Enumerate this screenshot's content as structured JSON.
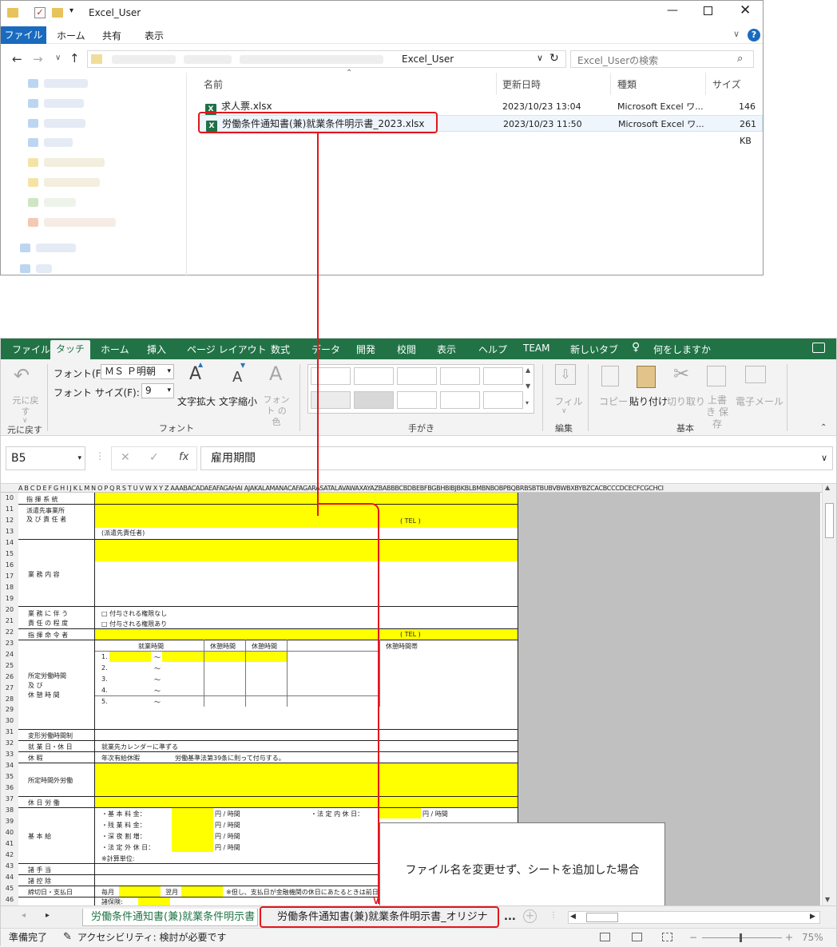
{
  "explorer": {
    "title": "Excel_User",
    "ribbon_tabs": [
      "ファイル",
      "ホーム",
      "共有",
      "表示"
    ],
    "address_tail": "Excel_User",
    "search_placeholder": "Excel_Userの検索",
    "columns": {
      "name": "名前",
      "date": "更新日時",
      "type": "種類",
      "size": "サイズ"
    },
    "files": [
      {
        "name": "求人票.xlsx",
        "date": "2023/10/23 13:04",
        "type": "Microsoft Excel ワ...",
        "size": "146 KB"
      },
      {
        "name": "労働条件通知書(兼)就業条件明示書_2023.xlsx",
        "date": "2023/10/23 11:50",
        "type": "Microsoft Excel ワ...",
        "size": "261 KB"
      }
    ]
  },
  "excel": {
    "menu": [
      "ファイル",
      "タッチ",
      "ホーム",
      "挿入",
      "ページ レイアウト",
      "数式",
      "データ",
      "開発",
      "校閲",
      "表示",
      "ヘルプ",
      "TEAM",
      "新しいタブ"
    ],
    "tell_me": "何をしますか",
    "ribbon": {
      "undo_label": "元に戻す",
      "undo_group": "元に戻す",
      "font_label": "フォント(F):",
      "font_value": "ＭＳ Ｐ明朝",
      "size_label": "フォント サイズ(F):",
      "size_value": "9",
      "grow": "文字拡大",
      "shrink": "文字縮小",
      "font_color": "フォント の色",
      "font_group": "フォント",
      "ink_group": "手がき",
      "fill": "フィル",
      "edit_group": "編集",
      "copy": "コピー",
      "paste": "貼り付け",
      "cut": "切り取り",
      "overwrite": "上書き 保存",
      "email": "電子メール",
      "basic_group": "基本"
    },
    "name_box": "B5",
    "formula": "雇用期間",
    "col_header": "A B C D E F G H I J K L M N O P Q R S T U V W X Y Z AAABACADAEAFAGAHAI AJAKALAMANACAFAGARASATALAVAWAXAYAZBABBBCBDBEBFBGBHBIBJBKBLBMBNBOBPBQBRBSBTBUBVBWBXBYBZCACBCCCDCECFCGCHCI",
    "rows": [
      "10",
      "11",
      "12",
      "13",
      "14",
      "15",
      "16",
      "17",
      "18",
      "19",
      "20",
      "21",
      "22",
      "23",
      "24",
      "25",
      "26",
      "27",
      "28",
      "29",
      "30",
      "31",
      "32",
      "33",
      "34",
      "35",
      "36",
      "37",
      "38",
      "39",
      "40",
      "41",
      "42",
      "43",
      "44",
      "45",
      "46"
    ],
    "labels": {
      "r10": "指 揮 系 統",
      "r11": "派遣先事業所",
      "r12": "及 び 責 任 者",
      "r13": "(派遣先責任者)",
      "tel": "( TEL )",
      "r16": "業 務 内 容",
      "r20a": "業 務 に 伴 う",
      "r21a": "責 任 の 程 度",
      "r20b": "□ 付与される権限なし",
      "r21b": "□ 付与される権限あり",
      "r22": "指 揮 命 令 者",
      "r23a": "就業時間",
      "r23b": "休憩時間",
      "r23c": "休憩時間",
      "r23d": "休憩時間帯",
      "t1": "1.",
      "t2": "2.",
      "t3": "3.",
      "t4": "4.",
      "t5": "5.",
      "tilde": "〜",
      "r25": "所定労働時間",
      "r26": "及 び",
      "r27": "休 憩 時 間",
      "r31": "変形労働時間制",
      "r32a": "就 業 日・休 日",
      "r32b": "就業先カレンダーに準ずる",
      "r33a": "休 暇",
      "r33b": "年次有給休暇",
      "r33c": "労働基準法第39条に則って付与する。",
      "r35": "所定時間外労働",
      "r37": "休 日 労 働",
      "r38": "・基 本 料 金：",
      "r39": "・残 業 料 金：",
      "r40": "・深 夜 割 増：",
      "r41": "・法 定 外 休 日：",
      "r42": "※計算単位:",
      "yen": "円 / 時間",
      "r38r": "・法 定 内 休 日：",
      "r40l": "基 本 給",
      "r43": "諸 手 当",
      "r44": "諸 控 除",
      "r45a": "締切日・支払日",
      "r45b": "毎月",
      "r45c": "翌月",
      "r45d": "※但し、支払日が金融機関の休日にあたるときは前日に繰り上げて支給する。",
      "r46": "諸保険:"
    },
    "note": "ファイル名を変更せず、シートを追加した場合",
    "sheets": [
      "労働条件通知書(兼)就業条件明示書",
      "労働条件通知書(兼)就業条件明示書_オリジナル"
    ],
    "more": "...",
    "status": {
      "ready": "準備完了",
      "access": "アクセシビリティ: 検討が必要です",
      "zoom": "75%"
    }
  },
  "colors": {
    "excel_green": "#217346",
    "annotation_red": "#e3161d",
    "cell_yellow": "#ffff00"
  }
}
